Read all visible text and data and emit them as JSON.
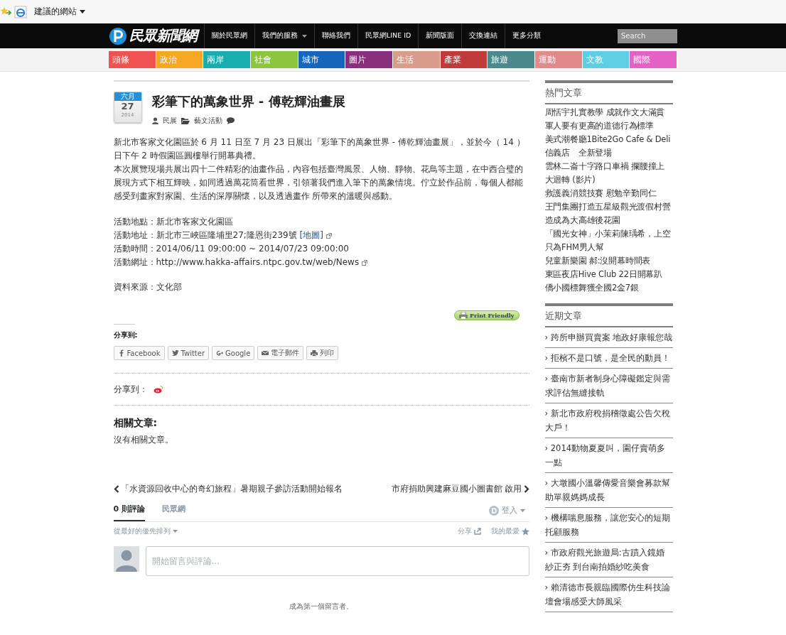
{
  "favorites_bar": {
    "label": "建議的網站"
  },
  "header": {
    "logo": "民眾新聞網",
    "nav": [
      {
        "label": "關於民眾網",
        "dropdown": false
      },
      {
        "label": "我們的服務",
        "dropdown": true
      },
      {
        "label": "聯絡我們",
        "dropdown": false
      },
      {
        "label": "民眾網LINE ID",
        "dropdown": false
      },
      {
        "label": "新聞版面",
        "dropdown": false
      },
      {
        "label": "交換連結",
        "dropdown": false
      },
      {
        "label": "更多分類",
        "dropdown": false
      }
    ],
    "search": {
      "placeholder": "Search"
    }
  },
  "categories": [
    {
      "label": "頭條",
      "color": "#f05252"
    },
    {
      "label": "政治",
      "color": "#f5a623"
    },
    {
      "label": "兩岸",
      "color": "#18aeb0"
    },
    {
      "label": "社會",
      "color": "#8cc63f"
    },
    {
      "label": "城市",
      "color": "#1666bd"
    },
    {
      "label": "圖片",
      "color": "#8a2e7e"
    },
    {
      "label": "生活",
      "color": "#d99c8a"
    },
    {
      "label": "產業",
      "color": "#c03a3c"
    },
    {
      "label": "旅遊",
      "color": "#4a8a8c"
    },
    {
      "label": "運動",
      "color": "#e08a8c"
    },
    {
      "label": "文教",
      "color": "#5ecee2"
    },
    {
      "label": "國際",
      "color": "#e462c4"
    }
  ],
  "article": {
    "date": {
      "month": "六月",
      "day": "27",
      "year": "2014"
    },
    "title": "彩筆下的萬象世界 - 傅乾輝油畫展",
    "author": "民展",
    "category": "藝文活動",
    "paragraphs": [
      "新北市客家文化園區於 6 月 11 日至 7 月 23 日展出「彩筆下的萬象世界 - 傅乾輝油畫展」，並於今（ 14 ）日下午 2 時假園區圓樓舉行開幕典禮。",
      "本次展覽現場共展出四十二件精彩的油畫作品，內容包括臺灣風景、人物、靜物、花鳥等主題，在中西合璧的展現方式下相互輝映，如同透過萬花筒看世界，引領著我們進入筆下的萬象情境。佇立於作品前，每個人都能感受到畫家對家園、生活的深厚關懷，以及透過畫作 所帶來的溫暖與感動。"
    ],
    "details": [
      {
        "text": "活動地點：新北市客家文化園區",
        "external": false
      },
      {
        "text": "活動地址：新北市三峽區隆埔里27;隆恩街239號",
        "link": "[地圖]",
        "external": true
      },
      {
        "text": "活動時間：2014/06/11 09:00:00 ~ 2014/07/23 09:00:00",
        "external": false
      },
      {
        "text": "活動網址：http://www.hakka-affairs.ntpc.gov.tw/web/News",
        "external": true
      }
    ],
    "source": "資料來源：文化部",
    "print_friendly": "Print Friendly",
    "share_heading": "分享到:",
    "share_buttons": [
      {
        "kind": "facebook",
        "label": "Facebook"
      },
      {
        "kind": "twitter",
        "label": "Twitter"
      },
      {
        "kind": "google",
        "label": "Google"
      },
      {
        "kind": "email",
        "label": "電子郵件"
      },
      {
        "kind": "print",
        "label": "列印"
      }
    ],
    "share_to": "分享到：",
    "related_heading": "相關文章:",
    "related_empty": "沒有相關文章。",
    "prev": "「水資源回收中心的奇幻旅程」暑期親子參訪活動開始報名",
    "next": "市府捐助興建麻豆國小圖書館 啟用"
  },
  "comments": {
    "tabs": [
      {
        "label": "0 則評論",
        "selected": true
      },
      {
        "label": "民眾網",
        "selected": false
      }
    ],
    "login": "登入",
    "sort": "從最好的優先排列",
    "share": "分享",
    "favorite": "我的最愛",
    "placeholder": "開始留言與評論...",
    "empty": "成為第一個留言者。"
  },
  "sidebar": {
    "popular": {
      "title": "熱門文章",
      "items": [
        "周恬宇扎實教學 成就作文大滿貫",
        "軍人要有更高的道德行為標準",
        "美式潮餐廳1Bite2Go Cafe & Deli 信義店　全新登場",
        "雲林二崙十字路口車禍 攔腰撞上大迴轉 (影片)",
        "救護義消競技賽 慰勉辛勤同仁",
        "王門集團打造五星級觀光渡假村營造成為大高雄後花園",
        "「國光女神」小茉莉陳瑀希，上空只為FHM男人幫",
        "兒童新樂園 郝:沒開幕時間表",
        "東區夜店Hive Club 22日開幕趴",
        "僑小國標舞獲全國2金7銀"
      ]
    },
    "recent": {
      "title": "近期文章",
      "items": [
        "› 跨所申辦買賣案 地政好康報您哉",
        "› 拒檳不是口號，是全民的動員！",
        "› 臺南市新者制身心障礙鑑定與需求評估無縫接軌",
        "› 新北市政府稅捐稽徵處公告欠稅大戶！",
        "› 2014動物夏夏叫，園仔賣萌多一點",
        "› 大墩國小溫馨傳愛音樂會募款幫助單親媽媽成長",
        "› 機構喘息服務，讓您安心的短期托顧服務",
        "› 市政府觀光旅遊局:古蹟入鏡婚紗正夯 到台南拍婚紗吃美食",
        "› 賴清德市長親臨國際仿生科技論壇會場感受大師風采"
      ]
    }
  }
}
